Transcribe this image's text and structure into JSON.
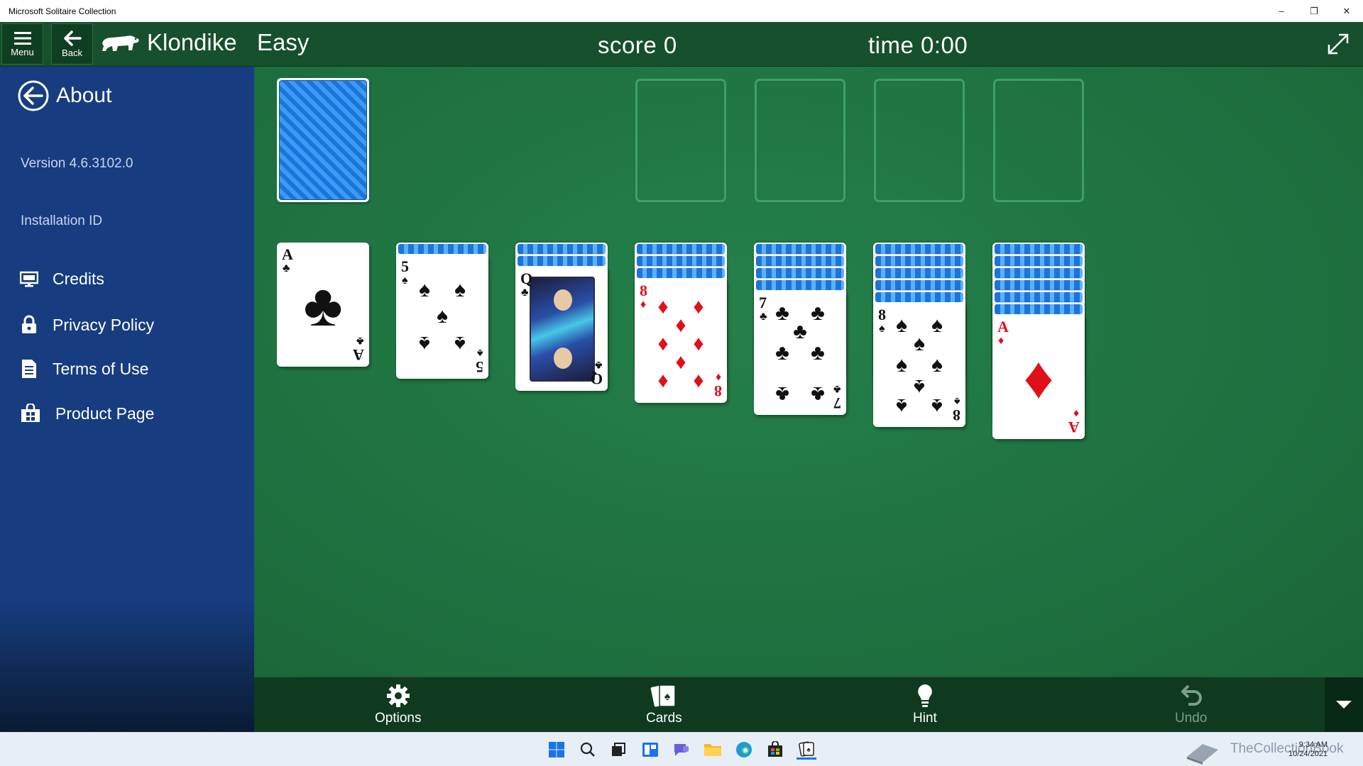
{
  "window": {
    "title": "Microsoft Solitaire Collection",
    "minimize_glyph": "–",
    "restore_glyph": "❐",
    "close_glyph": "✕"
  },
  "appbar": {
    "menu_label": "Menu",
    "back_label": "Back",
    "game_name": "Klondike",
    "difficulty": "Easy",
    "score_text": "score  0",
    "time_text": "time  0:00"
  },
  "sidebar": {
    "title": "About",
    "version": "Version 4.6.3102.0",
    "installation_id": "Installation ID",
    "links": [
      {
        "label": "Credits",
        "icon": "monitor-icon"
      },
      {
        "label": "Privacy Policy",
        "icon": "lock-icon"
      },
      {
        "label": "Terms of Use",
        "icon": "document-icon"
      },
      {
        "label": "Product Page",
        "icon": "store-icon"
      }
    ]
  },
  "board": {
    "stock": "face-down",
    "foundations": [
      "empty",
      "empty",
      "empty",
      "empty"
    ],
    "tableau": [
      {
        "hidden": 0,
        "top": {
          "rank": "A",
          "suit": "♣",
          "color": "black"
        }
      },
      {
        "hidden": 1,
        "top": {
          "rank": "5",
          "suit": "♠",
          "color": "black"
        }
      },
      {
        "hidden": 2,
        "top": {
          "rank": "Q",
          "suit": "♣",
          "color": "black"
        }
      },
      {
        "hidden": 3,
        "top": {
          "rank": "8",
          "suit": "♦",
          "color": "red"
        }
      },
      {
        "hidden": 4,
        "top": {
          "rank": "7",
          "suit": "♣",
          "color": "black"
        }
      },
      {
        "hidden": 5,
        "top": {
          "rank": "8",
          "suit": "♠",
          "color": "black"
        }
      },
      {
        "hidden": 6,
        "top": {
          "rank": "A",
          "suit": "♦",
          "color": "red"
        }
      }
    ]
  },
  "toolbar": {
    "options_label": "Options",
    "cards_label": "Cards",
    "hint_label": "Hint",
    "undo_label": "Undo"
  },
  "taskbar": {
    "time": "9:34 AM",
    "date": "10/24/2021",
    "watermark": "TheCollectionBook"
  },
  "colors": {
    "felt": "#1f7341",
    "sidebar": "#173d80",
    "appbar": "#16502c",
    "toolbar": "#0f3a20",
    "red_suit": "#e0101a"
  }
}
